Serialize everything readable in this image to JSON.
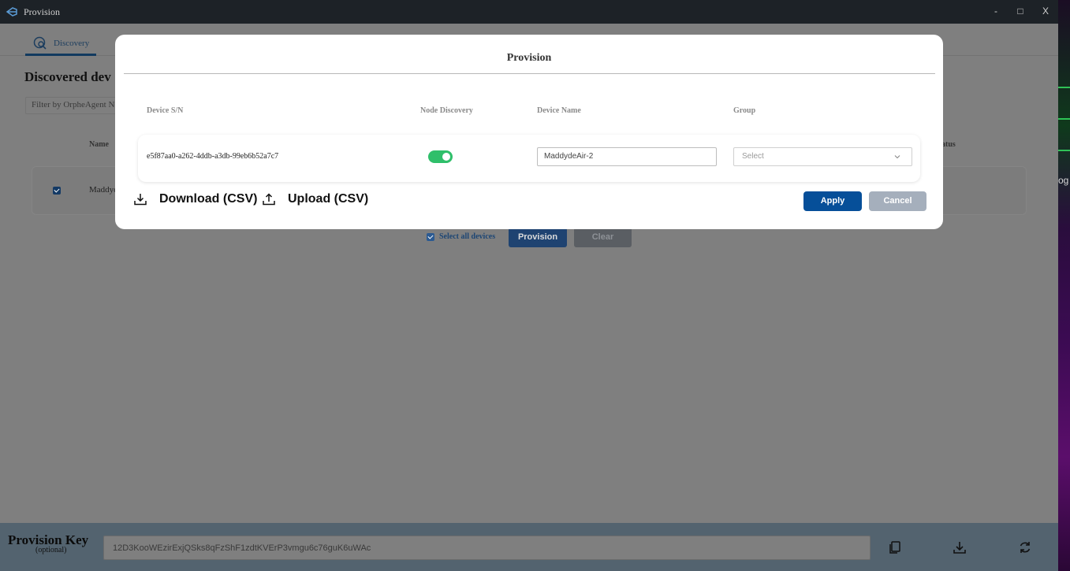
{
  "window": {
    "title": "Provision",
    "minimize": "-",
    "maximize": "□",
    "close": "X"
  },
  "tabs": [
    {
      "label": "Discovery"
    }
  ],
  "page": {
    "title": "Discovered dev",
    "filter_placeholder": "Filter by OrpheAgent N",
    "columns": {
      "name": "Name",
      "status": "atus"
    },
    "rows": [
      {
        "name": "Maddyc",
        "checked": true
      }
    ],
    "select_all_label": "Select all devices",
    "provision_label": "Provision",
    "clear_label": "Clear"
  },
  "modal": {
    "title": "Provision",
    "headers": {
      "serial": "Device S/N",
      "node_discovery": "Node Discovery",
      "device_name": "Device Name",
      "group": "Group"
    },
    "row": {
      "serial": "e5f87aa0-a262-4ddb-a3db-99eb6b52a7c7",
      "node_discovery": true,
      "device_name": "MaddydeAir-2",
      "group_placeholder": "Select"
    },
    "download_label": "Download (CSV)",
    "upload_label": "Upload (CSV)",
    "apply_label": "Apply",
    "cancel_label": "Cancel"
  },
  "footer": {
    "label": "Provision Key",
    "sublabel": "(optional)",
    "key_value": "12D3KooWEzirExjQSks8qFzShF1zdtKVErP3vmgu6c76guK6uWAc"
  },
  "desktop": {
    "fragment": "og"
  },
  "colors": {
    "accent": "#064f99",
    "toggle_on": "#2fbf6a",
    "overlay": "#7f7f7f"
  }
}
